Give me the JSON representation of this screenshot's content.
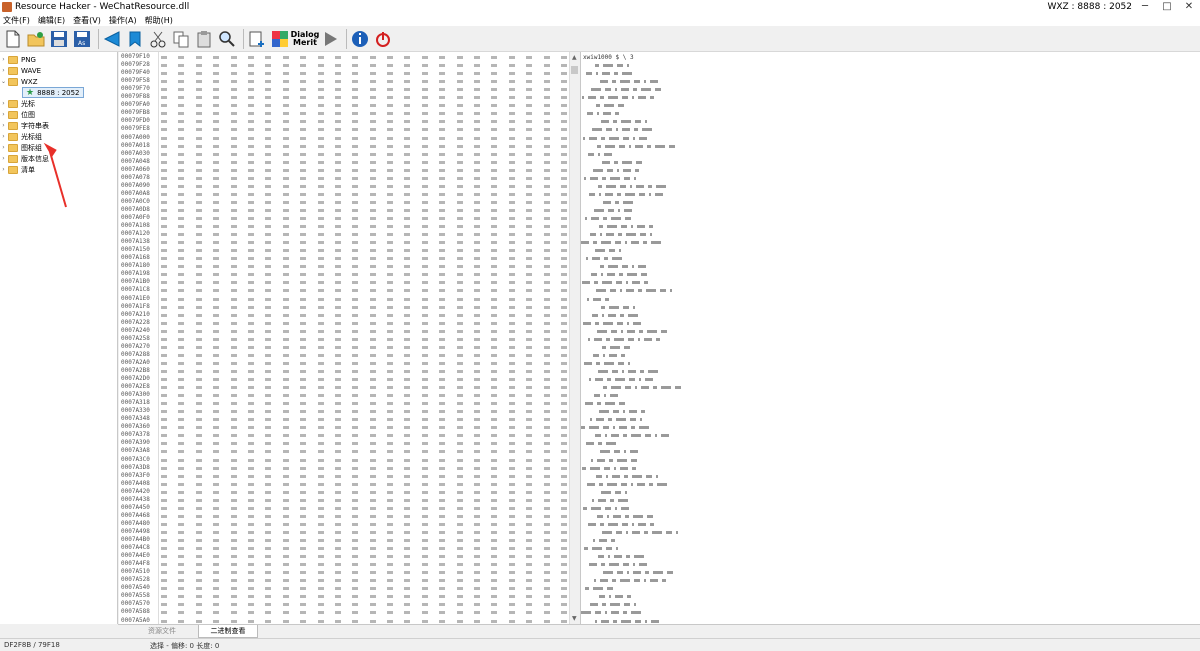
{
  "window": {
    "title": "Resource Hacker - WeChatResource.dll",
    "status_right": "WXZ : 8888 : 2052",
    "minimize": "─",
    "maximize": "□",
    "close": "✕"
  },
  "menu": [
    {
      "label": "文件(F)"
    },
    {
      "label": "编辑(E)"
    },
    {
      "label": "查看(V)"
    },
    {
      "label": "操作(A)"
    },
    {
      "label": "帮助(H)"
    }
  ],
  "toolbar": {
    "dialog_label_1": "Dialog",
    "dialog_label_2": "Merit",
    "icons": [
      "new-file-icon",
      "open-icon",
      "save-icon",
      "save-as-icon",
      "back-icon",
      "forward-icon",
      "cut-icon",
      "copy-icon",
      "paste-icon",
      "search-icon",
      "add-resource-icon",
      "replace-resource-icon",
      "dialog-merge-icon",
      "play-icon",
      "info-icon",
      "power-icon"
    ]
  },
  "tree": {
    "items": [
      {
        "label": "PNG",
        "expanded": false
      },
      {
        "label": "WAVE",
        "expanded": false
      },
      {
        "label": "WXZ",
        "expanded": true
      },
      {
        "label": "8888 : 2052",
        "selected": true
      },
      {
        "label": "光标",
        "expanded": false
      },
      {
        "label": "位图",
        "expanded": false
      },
      {
        "label": "字符串表",
        "expanded": false
      },
      {
        "label": "光标组",
        "expanded": false
      },
      {
        "label": "图标组",
        "expanded": false
      },
      {
        "label": "版本信息",
        "expanded": false
      },
      {
        "label": "清单",
        "expanded": false
      }
    ]
  },
  "hex": {
    "addresses": [
      "00079F10",
      "00079F28",
      "00079F40",
      "00079F58",
      "00079F70",
      "00079F88",
      "00079FA0",
      "00079FB8",
      "00079FD0",
      "00079FE8",
      "0007A000",
      "0007A018",
      "0007A030",
      "0007A048",
      "0007A060",
      "0007A078",
      "0007A090",
      "0007A0A8",
      "0007A0C0",
      "0007A0D8",
      "0007A0F0",
      "0007A108",
      "0007A120",
      "0007A138",
      "0007A150",
      "0007A168",
      "0007A180",
      "0007A198",
      "0007A1B0",
      "0007A1C8",
      "0007A1E0",
      "0007A1F8",
      "0007A210",
      "0007A228",
      "0007A240",
      "0007A258",
      "0007A270",
      "0007A288",
      "0007A2A0",
      "0007A2B8",
      "0007A2D0",
      "0007A2E8",
      "0007A300",
      "0007A318",
      "0007A330",
      "0007A348",
      "0007A360",
      "0007A378",
      "0007A390",
      "0007A3A8",
      "0007A3C0",
      "0007A3D8",
      "0007A3F0",
      "0007A408",
      "0007A420",
      "0007A438",
      "0007A450",
      "0007A468",
      "0007A480",
      "0007A498",
      "0007A4B0",
      "0007A4C8",
      "0007A4E0",
      "0007A4F8",
      "0007A510",
      "0007A528",
      "0007A540",
      "0007A558",
      "0007A570",
      "0007A588",
      "0007A5A0"
    ],
    "first_text_line": "xwiw1000     $   \\        3"
  },
  "tabs": [
    {
      "label": "资源文件"
    },
    {
      "label": "二进制查看",
      "active": true
    }
  ],
  "status": {
    "left": "DF2F8B / 79F18",
    "right": "选择 - 偏移: 0 长度: 0"
  }
}
